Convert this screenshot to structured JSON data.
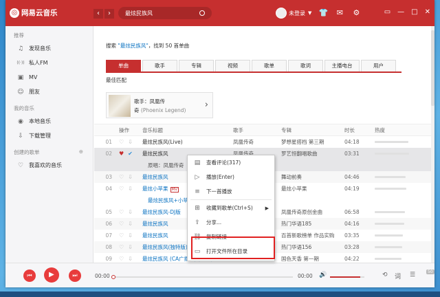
{
  "app": {
    "logo_text": "网易云音乐",
    "search_value": "最炫民族风",
    "login_text": "未登录",
    "nav_back": "‹",
    "nav_forward": "›"
  },
  "sidebar": {
    "section_recommend": "推荐",
    "items_recommend": [
      {
        "label": "发现音乐",
        "icon": "music-note-icon"
      },
      {
        "label": "私人FM",
        "icon": "radio-icon"
      },
      {
        "label": "MV",
        "icon": "video-icon"
      },
      {
        "label": "朋友",
        "icon": "friends-icon"
      }
    ],
    "section_my_music": "我的音乐",
    "items_my_music": [
      {
        "label": "本地音乐",
        "icon": "local-music-icon"
      },
      {
        "label": "下载管理",
        "icon": "download-icon"
      }
    ],
    "section_playlists": "创建的歌单",
    "items_playlists": [
      {
        "label": "我喜欢的音乐",
        "icon": "heart-icon"
      }
    ]
  },
  "search_result": {
    "prefix": "搜索",
    "keyword": "\"最炫民族风\"",
    "suffix": "，找到 50 首单曲"
  },
  "tabs": [
    "单曲",
    "歌手",
    "专辑",
    "视频",
    "歌单",
    "歌词",
    "主播电台",
    "用户"
  ],
  "best_match": "最佳匹配",
  "artist_card": {
    "name_label": "歌手：凤凰传",
    "name_rest": "奇",
    "name_en": "(Phoenix Legend)"
  },
  "table": {
    "headers": {
      "op": "操作",
      "title": "音乐标题",
      "artist": "歌手",
      "album": "专辑",
      "time": "时长",
      "hot": "热度"
    },
    "rows": [
      {
        "no": "01",
        "title": "最炫民族风(Live)",
        "artist": "凤凰传奇",
        "album": "梦想星搭档 第三期",
        "time": "04:18",
        "hot": 0.88,
        "blue": false
      },
      {
        "no": "02",
        "title": "最炫民族风",
        "artist": "凤凰传奇",
        "album": "罗艺恒翻唱歌曲",
        "time": "03:31",
        "hot": 0.9,
        "blue": false,
        "selected": true,
        "liked": true
      },
      {
        "sub": "原唱：凤凰传奇"
      },
      {
        "no": "03",
        "title": "最炫民族风",
        "artist": "",
        "album": "舞动前奏",
        "time": "04:46",
        "hot": 0.8,
        "blue": true
      },
      {
        "no": "04",
        "title": "最炫小苹果",
        "artist": "",
        "album": "最炫小苹果",
        "time": "04:19",
        "hot": 0.82,
        "blue": true,
        "mv": "MV"
      },
      {
        "sub": "最炫民族风+小苹果",
        "sub_blue": true
      },
      {
        "no": "05",
        "title": "最炫民族风-DJ版",
        "artist": "",
        "album": "凤凰传奇原创金曲",
        "time": "06:58",
        "hot": 0.78,
        "blue": true
      },
      {
        "no": "06",
        "title": "最炫民族风",
        "artist": "",
        "album": "热门华语185",
        "time": "04:16",
        "hot": 0.76,
        "blue": true
      },
      {
        "no": "07",
        "title": "最炫民族风",
        "artist": "",
        "album": "百首新歌榜单 作品实购",
        "time": "03:35",
        "hot": 0.74,
        "blue": true
      },
      {
        "no": "08",
        "title": "最炫民族风(独特版)",
        "artist": "",
        "album": "热门华语156",
        "time": "03:28",
        "hot": 0.72,
        "blue": true
      },
      {
        "no": "09",
        "title": "最炫民族风 (CA广播版) (Live)",
        "artist": "王蓉",
        "album": "国色天香 第一期",
        "time": "04:22",
        "hot": 0.7,
        "blue": true
      }
    ]
  },
  "context_menu": [
    {
      "label": "查看评论(317)",
      "icon": "comment-icon"
    },
    {
      "label": "播放(Enter)",
      "icon": "play-icon"
    },
    {
      "label": "下一首播放",
      "icon": "next-play-icon"
    },
    {
      "sep": true
    },
    {
      "label": "收藏到歌单(Ctrl+S)",
      "icon": "add-to-playlist-icon",
      "submenu": true
    },
    {
      "label": "分享...",
      "icon": "share-icon"
    },
    {
      "label": "复制链接",
      "icon": "link-icon"
    },
    {
      "label": "打开文件所在目录",
      "icon": "folder-icon"
    }
  ],
  "player": {
    "current_time": "00:00",
    "total_time": "00:00",
    "progress": 0,
    "volume": 0.88,
    "lyric_label": "词",
    "queue_count": "50"
  },
  "colors": {
    "brand": "#c62f2f",
    "link": "#0c73c2",
    "highlight_box": "#e02020"
  }
}
